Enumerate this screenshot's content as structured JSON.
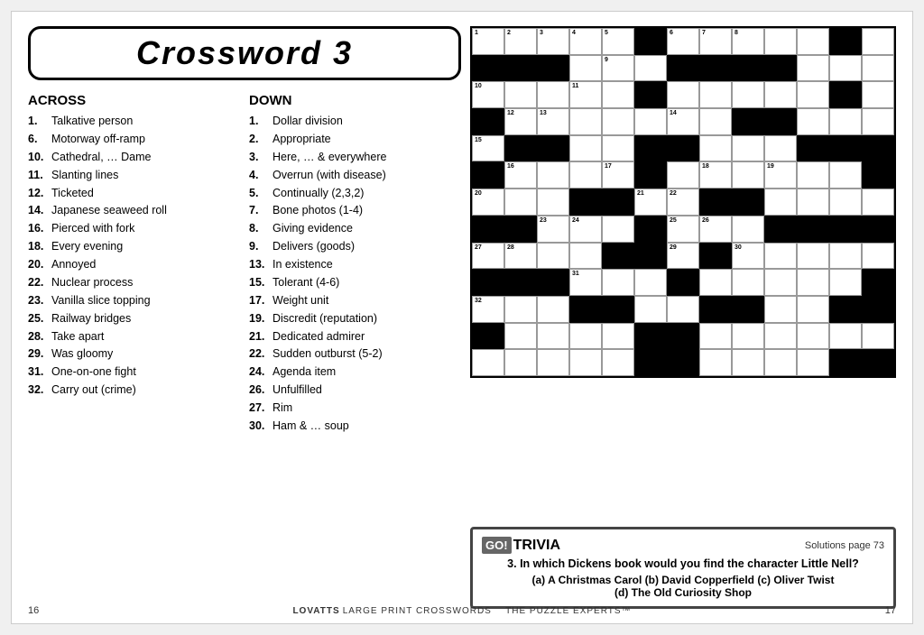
{
  "title": "Crossword  3",
  "across_label": "ACROSS",
  "down_label": "DOWN",
  "across_clues": [
    {
      "num": "1.",
      "text": "Talkative person"
    },
    {
      "num": "6.",
      "text": "Motorway off-ramp"
    },
    {
      "num": "10.",
      "text": "Cathedral, … Dame"
    },
    {
      "num": "11.",
      "text": "Slanting lines"
    },
    {
      "num": "12.",
      "text": "Ticketed"
    },
    {
      "num": "14.",
      "text": "Japanese seaweed roll"
    },
    {
      "num": "16.",
      "text": "Pierced with fork"
    },
    {
      "num": "18.",
      "text": "Every evening"
    },
    {
      "num": "20.",
      "text": "Annoyed"
    },
    {
      "num": "22.",
      "text": "Nuclear process"
    },
    {
      "num": "23.",
      "text": "Vanilla slice topping"
    },
    {
      "num": "25.",
      "text": "Railway bridges"
    },
    {
      "num": "28.",
      "text": "Take apart"
    },
    {
      "num": "29.",
      "text": "Was gloomy"
    },
    {
      "num": "31.",
      "text": "One-on-one fight"
    },
    {
      "num": "32.",
      "text": "Carry out (crime)"
    }
  ],
  "down_clues": [
    {
      "num": "1.",
      "text": "Dollar division"
    },
    {
      "num": "2.",
      "text": "Appropriate"
    },
    {
      "num": "3.",
      "text": "Here, … & everywhere"
    },
    {
      "num": "4.",
      "text": "Overrun (with disease)"
    },
    {
      "num": "5.",
      "text": "Continually (2,3,2)"
    },
    {
      "num": "7.",
      "text": "Bone photos (1-4)"
    },
    {
      "num": "8.",
      "text": "Giving evidence"
    },
    {
      "num": "9.",
      "text": "Delivers (goods)"
    },
    {
      "num": "13.",
      "text": "In existence"
    },
    {
      "num": "15.",
      "text": "Tolerant (4-6)"
    },
    {
      "num": "17.",
      "text": "Weight unit"
    },
    {
      "num": "19.",
      "text": "Discredit (reputation)"
    },
    {
      "num": "21.",
      "text": "Dedicated admirer"
    },
    {
      "num": "22.",
      "text": "Sudden outburst (5-2)"
    },
    {
      "num": "24.",
      "text": "Agenda item"
    },
    {
      "num": "26.",
      "text": "Unfulfilled"
    },
    {
      "num": "27.",
      "text": "Rim"
    },
    {
      "num": "30.",
      "text": "Ham & … soup"
    }
  ],
  "trivia": {
    "logo_box": "GO!",
    "logo_text": "TRIVIA",
    "solutions": "Solutions page 73",
    "number": "3.",
    "question": "In which Dickens book would you find the character Little Nell?",
    "answers": "(a) A Christmas Carol  (b) David Copperfield  (c) Oliver Twist\n(d) The Old Curiosity Shop"
  },
  "footer": {
    "page_left": "16",
    "page_right": "17",
    "brand": "LOVATTS",
    "subtitle": "LARGE PRINT CROSSWORDS",
    "tagline": "The puzzle experts™"
  }
}
